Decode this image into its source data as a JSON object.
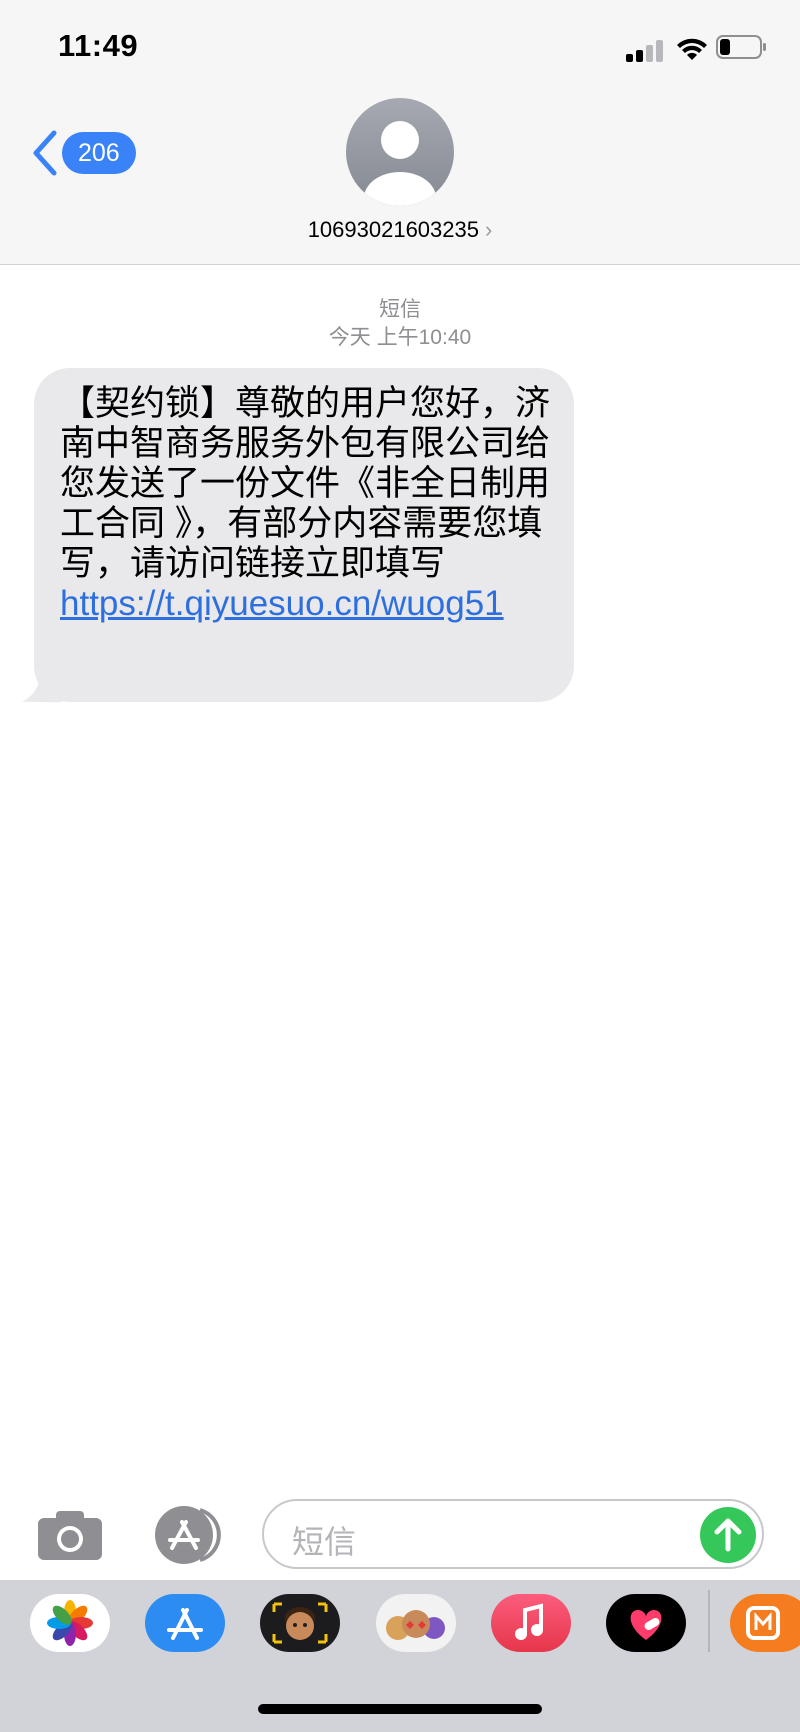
{
  "status_bar": {
    "time": "11:49"
  },
  "nav": {
    "unread_count": "206",
    "contact_number": "10693021603235",
    "chevron": "›"
  },
  "conversation": {
    "service_label": "短信",
    "timestamp": "今天 上午10:40"
  },
  "message": {
    "text": "【契约锁】尊敬的用户您好，济南中智商务服务外包有限公司给您发送了一份文件《非全日制用工合同 》，有部分内容需要您填写，请访问链接立即填写 ",
    "link": "https://t.qiyuesuo.cn/wuog51"
  },
  "compose": {
    "placeholder": "短信"
  },
  "icons": [
    "back-chevron-icon",
    "contact-avatar-icon",
    "camera-icon",
    "app-store-icon",
    "send-arrow-icon",
    "photos-icon",
    "memoji-icon",
    "animoji-icon",
    "music-icon",
    "heart-app-icon",
    "mango-tv-icon"
  ],
  "colors": {
    "accent": "#3a82f7",
    "send": "#35c759",
    "bubble": "#e9e9eb",
    "link": "#2e6fe0"
  }
}
